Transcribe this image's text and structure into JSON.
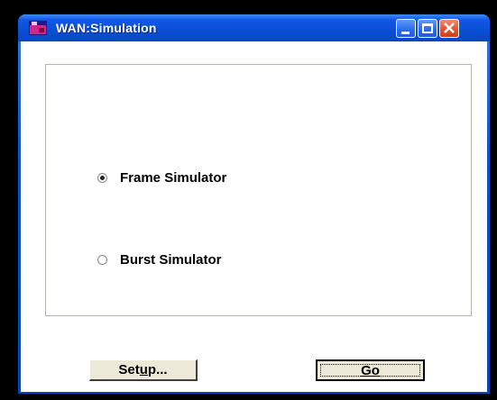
{
  "window": {
    "title": "WAN:Simulation",
    "icon": "app-icon"
  },
  "titlebar_buttons": [
    "minimize-icon",
    "maximize-icon",
    "close-icon"
  ],
  "options": [
    {
      "label": "Frame Simulator",
      "checked": true
    },
    {
      "label": "Burst Simulator",
      "checked": false
    }
  ],
  "buttons": {
    "setup_label_pre": "Set",
    "setup_label_u": "u",
    "setup_label_post": "p...",
    "go_label": "Go"
  },
  "colors": {
    "titlebar": "#0b4fd4",
    "close": "#e0562e",
    "face": "#ece9d8"
  }
}
